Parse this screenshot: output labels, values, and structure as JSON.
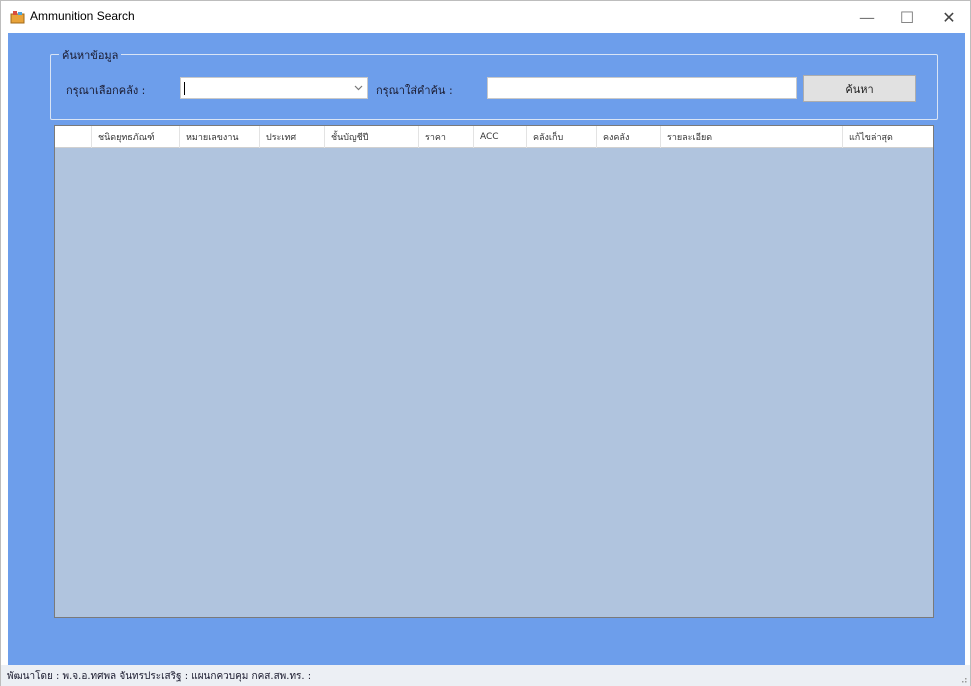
{
  "window": {
    "title": "Ammunition Search",
    "minimize_glyph": "—",
    "maximize_glyph": "☐",
    "close_glyph": "✕"
  },
  "search_panel": {
    "group_title": "ค้นหาข้อมูล",
    "warehouse_label": "กรุณาเลือกคลัง :",
    "warehouse_value": "",
    "keyword_label": "กรุณาใส่คำค้น :",
    "keyword_value": "",
    "search_button_label": "ค้นหา"
  },
  "grid": {
    "columns": [
      "",
      "ชนิดยุทธภัณฑ์",
      "หมายเลขงาน",
      "ประเทศ",
      "ชั้นบัญชีปี",
      "ราคา",
      "ACC",
      "คลังเก็บ",
      "คงคลัง",
      "รายละเอียด",
      "แก้ไขล่าสุด"
    ],
    "rows": []
  },
  "statusbar": {
    "text": "พัฒนาโดย : พ.จ.อ.ทศพล จันทรประเสริฐ : แผนกควบคุม กคส.สพ.ทร. :"
  },
  "colors": {
    "client_bg": "#6d9eeb",
    "grid_bg": "#b0c4de",
    "button_bg": "#e1e1e1"
  }
}
